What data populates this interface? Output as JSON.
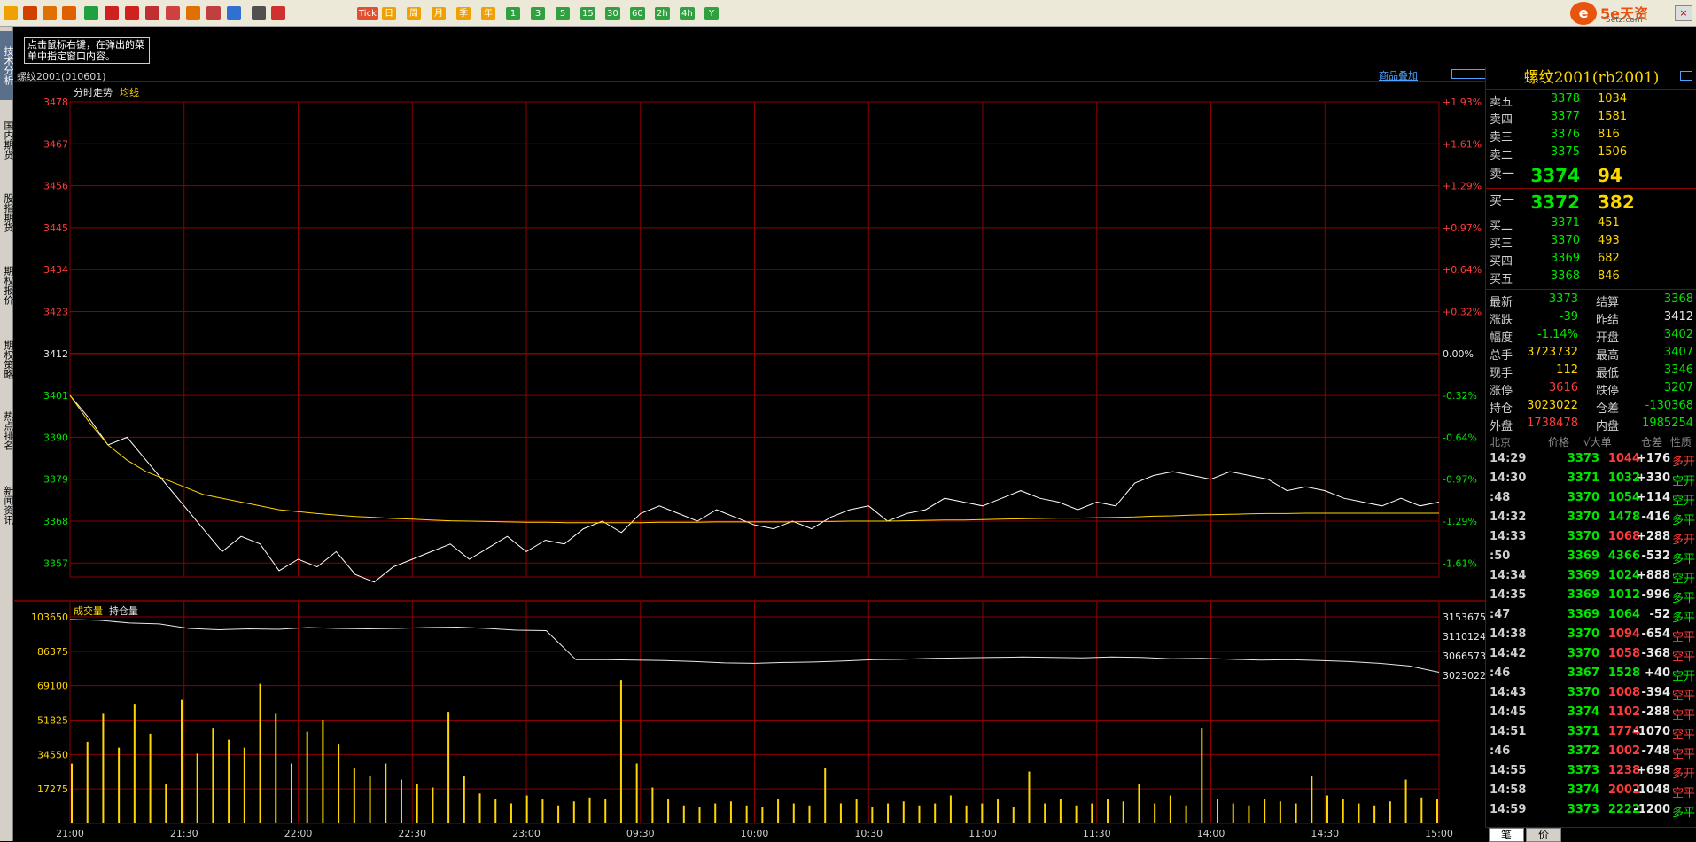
{
  "toolbar": {
    "icons": [
      "back-arrow-icon",
      "home-icon",
      "book-icon",
      "f10-icon",
      "refresh-icon",
      "zoom-in-icon",
      "zoom-out-icon",
      "window-icon",
      "pen-icon",
      "drawing-icon",
      "filter-icon",
      "news-icon",
      "grid-icon",
      "chart-icon"
    ],
    "periods": [
      "Tick",
      "日",
      "周",
      "月",
      "季",
      "年",
      "1",
      "3",
      "5",
      "15",
      "30",
      "60",
      "2h",
      "4h",
      "Y"
    ],
    "brand": "5e天资",
    "brand_sub": "5etz.com"
  },
  "sidebar": {
    "tabs": [
      "技术分析",
      "国内期货",
      "股指期货",
      "期权报价",
      "期权策略",
      "热点排名",
      "新闻资讯"
    ]
  },
  "tooltip": "点击鼠标右键，在弹出的菜单中指定窗口内容。",
  "chart_header": {
    "title": "螺纹2001(010601)",
    "overlay_link": "商品叠加"
  },
  "chart_data": {
    "type": "line",
    "price_label": "分时走势",
    "avg_label": "均线",
    "volume_label": "成交量",
    "oi_label": "持仓量",
    "prev_settle": 3412,
    "price_axis": [
      3478,
      3467,
      3456,
      3445,
      3434,
      3423,
      3412,
      3401,
      3390,
      3379,
      3368,
      3357
    ],
    "pct_axis": [
      "+1.93%",
      "+1.61%",
      "+1.29%",
      "+0.97%",
      "+0.64%",
      "+0.32%",
      "0.00%",
      "-0.32%",
      "-0.64%",
      "-0.97%",
      "-1.29%",
      "-1.61%"
    ],
    "volume_axis": [
      103650,
      86375,
      69100,
      51825,
      34550,
      17275
    ],
    "oi_axis": [
      3153675,
      3110124,
      3066573,
      3023022
    ],
    "time_axis": [
      "21:00",
      "21:30",
      "22:00",
      "22:30",
      "23:00",
      "09:30",
      "10:00",
      "10:30",
      "11:00",
      "11:30",
      "14:00",
      "14:30",
      "15:00"
    ],
    "price_series": [
      3401,
      3395,
      3388,
      3390,
      3384,
      3378,
      3372,
      3366,
      3360,
      3364,
      3362,
      3355,
      3358,
      3356,
      3360,
      3354,
      3352,
      3356,
      3358,
      3360,
      3362,
      3358,
      3361,
      3364,
      3360,
      3363,
      3362,
      3366,
      3368,
      3365,
      3370,
      3372,
      3370,
      3368,
      3371,
      3369,
      3367,
      3366,
      3368,
      3366,
      3369,
      3371,
      3372,
      3368,
      3370,
      3371,
      3374,
      3373,
      3372,
      3374,
      3376,
      3374,
      3373,
      3371,
      3373,
      3372,
      3378,
      3380,
      3381,
      3380,
      3379,
      3381,
      3380,
      3379,
      3376,
      3377,
      3376,
      3374,
      3373,
      3372,
      3374,
      3372,
      3373
    ],
    "avg_series": [
      3401,
      3394,
      3388,
      3384,
      3381,
      3379,
      3377,
      3375,
      3374,
      3373,
      3372,
      3371,
      3370.5,
      3370,
      3369.6,
      3369.2,
      3369,
      3368.7,
      3368.5,
      3368.3,
      3368.1,
      3368,
      3367.9,
      3367.8,
      3367.7,
      3367.7,
      3367.6,
      3367.6,
      3367.6,
      3367.6,
      3367.6,
      3367.7,
      3367.7,
      3367.7,
      3367.8,
      3367.8,
      3367.8,
      3367.8,
      3367.8,
      3367.9,
      3367.9,
      3368,
      3368,
      3368,
      3368.1,
      3368.2,
      3368.3,
      3368.3,
      3368.4,
      3368.5,
      3368.6,
      3368.7,
      3368.8,
      3368.8,
      3368.9,
      3369,
      3369.1,
      3369.3,
      3369.4,
      3369.6,
      3369.7,
      3369.8,
      3369.9,
      3370,
      3370,
      3370.1,
      3370.1,
      3370.1,
      3370.1,
      3370.1,
      3370.1,
      3370.1,
      3370.1
    ],
    "oi_series": [
      3148000,
      3146000,
      3140000,
      3138000,
      3128000,
      3125000,
      3127000,
      3126000,
      3130000,
      3128000,
      3127000,
      3128000,
      3130000,
      3131000,
      3128000,
      3124000,
      3123000,
      3058000,
      3058000,
      3057000,
      3056000,
      3054000,
      3051000,
      3050000,
      3052000,
      3053000,
      3055000,
      3058000,
      3059000,
      3061000,
      3062000,
      3063000,
      3064000,
      3063000,
      3062000,
      3064000,
      3063000,
      3060000,
      3061000,
      3059000,
      3057000,
      3058000,
      3056000,
      3054000,
      3050000,
      3044000,
      3030000
    ],
    "volume_series": [
      30000,
      41000,
      55000,
      38000,
      60000,
      45000,
      20000,
      62000,
      35000,
      48000,
      42000,
      38000,
      70000,
      55000,
      30000,
      46000,
      52000,
      40000,
      28000,
      24000,
      30000,
      22000,
      20000,
      18000,
      56000,
      24000,
      15000,
      12000,
      10000,
      14000,
      12000,
      9000,
      11000,
      13000,
      12000,
      72000,
      30000,
      18000,
      12000,
      9000,
      8000,
      10000,
      11000,
      9000,
      8000,
      12000,
      10000,
      9000,
      28000,
      10000,
      12000,
      8000,
      10000,
      11000,
      9000,
      10000,
      14000,
      9000,
      10000,
      12000,
      8000,
      26000,
      10000,
      12000,
      9000,
      10000,
      12000,
      11000,
      20000,
      10000,
      14000,
      9000,
      48000,
      12000,
      10000,
      9000,
      12000,
      11000,
      10000,
      24000,
      14000,
      12000,
      10000,
      9000,
      11000,
      22000,
      13000,
      12000
    ]
  },
  "quote_panel": {
    "title": "螺纹2001(rb2001)",
    "asks": [
      {
        "label": "卖五",
        "price": "3378",
        "qty": "1034"
      },
      {
        "label": "卖四",
        "price": "3377",
        "qty": "1581"
      },
      {
        "label": "卖三",
        "price": "3376",
        "qty": "816"
      },
      {
        "label": "卖二",
        "price": "3375",
        "qty": "1506"
      },
      {
        "label": "卖一",
        "price": "3374",
        "qty": "94"
      }
    ],
    "bids": [
      {
        "label": "买一",
        "price": "3372",
        "qty": "382"
      },
      {
        "label": "买二",
        "price": "3371",
        "qty": "451"
      },
      {
        "label": "买三",
        "price": "3370",
        "qty": "493"
      },
      {
        "label": "买四",
        "price": "3369",
        "qty": "682"
      },
      {
        "label": "买五",
        "price": "3368",
        "qty": "846"
      }
    ],
    "stats": [
      {
        "k1": "最新",
        "v1": "3373",
        "c1": "green",
        "k2": "结算",
        "v2": "3368",
        "c2": "green"
      },
      {
        "k1": "涨跌",
        "v1": "-39",
        "c1": "green",
        "k2": "昨结",
        "v2": "3412",
        "c2": "white"
      },
      {
        "k1": "幅度",
        "v1": "-1.14%",
        "c1": "green",
        "k2": "开盘",
        "v2": "3402",
        "c2": "green"
      },
      {
        "k1": "总手",
        "v1": "3723732",
        "c1": "yellow",
        "k2": "最高",
        "v2": "3407",
        "c2": "green"
      },
      {
        "k1": "现手",
        "v1": "112",
        "c1": "yellow",
        "k2": "最低",
        "v2": "3346",
        "c2": "green"
      },
      {
        "k1": "涨停",
        "v1": "3616",
        "c1": "red",
        "k2": "跌停",
        "v2": "3207",
        "c2": "green"
      },
      {
        "k1": "持仓",
        "v1": "3023022",
        "c1": "yellow",
        "k2": "仓差",
        "v2": "-130368",
        "c2": "green"
      },
      {
        "k1": "外盘",
        "v1": "1738478",
        "c1": "red",
        "k2": "内盘",
        "v2": "1985254",
        "c2": "green"
      }
    ],
    "tick_header": {
      "time": "北京",
      "price": "价格",
      "size": "√大单",
      "delta": "仓差",
      "nature": "性质"
    },
    "ticks": [
      {
        "t": "14:29",
        "p": "3373",
        "s": "1044",
        "d": "+176",
        "n": "多开",
        "pc": "green",
        "sc": "red",
        "nc": "red"
      },
      {
        "t": "14:30",
        "p": "3371",
        "s": "1032",
        "d": "+330",
        "n": "空开",
        "pc": "green",
        "sc": "green",
        "nc": "green"
      },
      {
        "t": ":48",
        "p": "3370",
        "s": "1054",
        "d": "+114",
        "n": "空开",
        "pc": "green",
        "sc": "green",
        "nc": "green"
      },
      {
        "t": "14:32",
        "p": "3370",
        "s": "1478",
        "d": "-416",
        "n": "多平",
        "pc": "green",
        "sc": "green",
        "nc": "green"
      },
      {
        "t": "14:33",
        "p": "3370",
        "s": "1068",
        "d": "+288",
        "n": "多开",
        "pc": "green",
        "sc": "red",
        "nc": "red"
      },
      {
        "t": ":50",
        "p": "3369",
        "s": "4366",
        "d": "-532",
        "n": "多平",
        "pc": "green",
        "sc": "green",
        "nc": "green"
      },
      {
        "t": "14:34",
        "p": "3369",
        "s": "1024",
        "d": "+888",
        "n": "空开",
        "pc": "green",
        "sc": "green",
        "nc": "green"
      },
      {
        "t": "14:35",
        "p": "3369",
        "s": "1012",
        "d": "-996",
        "n": "多平",
        "pc": "green",
        "sc": "green",
        "nc": "green"
      },
      {
        "t": ":47",
        "p": "3369",
        "s": "1064",
        "d": "-52",
        "n": "多平",
        "pc": "green",
        "sc": "green",
        "nc": "green"
      },
      {
        "t": "14:38",
        "p": "3370",
        "s": "1094",
        "d": "-654",
        "n": "空平",
        "pc": "green",
        "sc": "red",
        "nc": "red"
      },
      {
        "t": "14:42",
        "p": "3370",
        "s": "1058",
        "d": "-368",
        "n": "空平",
        "pc": "green",
        "sc": "red",
        "nc": "red"
      },
      {
        "t": ":46",
        "p": "3367",
        "s": "1528",
        "d": "+40",
        "n": "空开",
        "pc": "green",
        "sc": "green",
        "nc": "green"
      },
      {
        "t": "14:43",
        "p": "3370",
        "s": "1008",
        "d": "-394",
        "n": "空平",
        "pc": "green",
        "sc": "red",
        "nc": "red"
      },
      {
        "t": "14:45",
        "p": "3374",
        "s": "1102",
        "d": "-288",
        "n": "空平",
        "pc": "green",
        "sc": "red",
        "nc": "red"
      },
      {
        "t": "14:51",
        "p": "3371",
        "s": "1774",
        "d": "-1070",
        "n": "空平",
        "pc": "green",
        "sc": "red",
        "nc": "red"
      },
      {
        "t": ":46",
        "p": "3372",
        "s": "1002",
        "d": "-748",
        "n": "空平",
        "pc": "green",
        "sc": "red",
        "nc": "red"
      },
      {
        "t": "14:55",
        "p": "3373",
        "s": "1238",
        "d": "+698",
        "n": "多开",
        "pc": "green",
        "sc": "red",
        "nc": "red"
      },
      {
        "t": "14:58",
        "p": "3374",
        "s": "2002",
        "d": "-1048",
        "n": "空平",
        "pc": "green",
        "sc": "red",
        "nc": "red"
      },
      {
        "t": "14:59",
        "p": "3373",
        "s": "2222",
        "d": "-1200",
        "n": "多平",
        "pc": "green",
        "sc": "green",
        "nc": "green"
      }
    ],
    "bottom_tabs": [
      "笔",
      "价"
    ]
  },
  "colors": {
    "grid": "#8a0000",
    "price": "#ffffff",
    "avg": "#ffd700",
    "volume": "#ffd700",
    "up": "#ff3c3c",
    "down": "#00e600"
  }
}
